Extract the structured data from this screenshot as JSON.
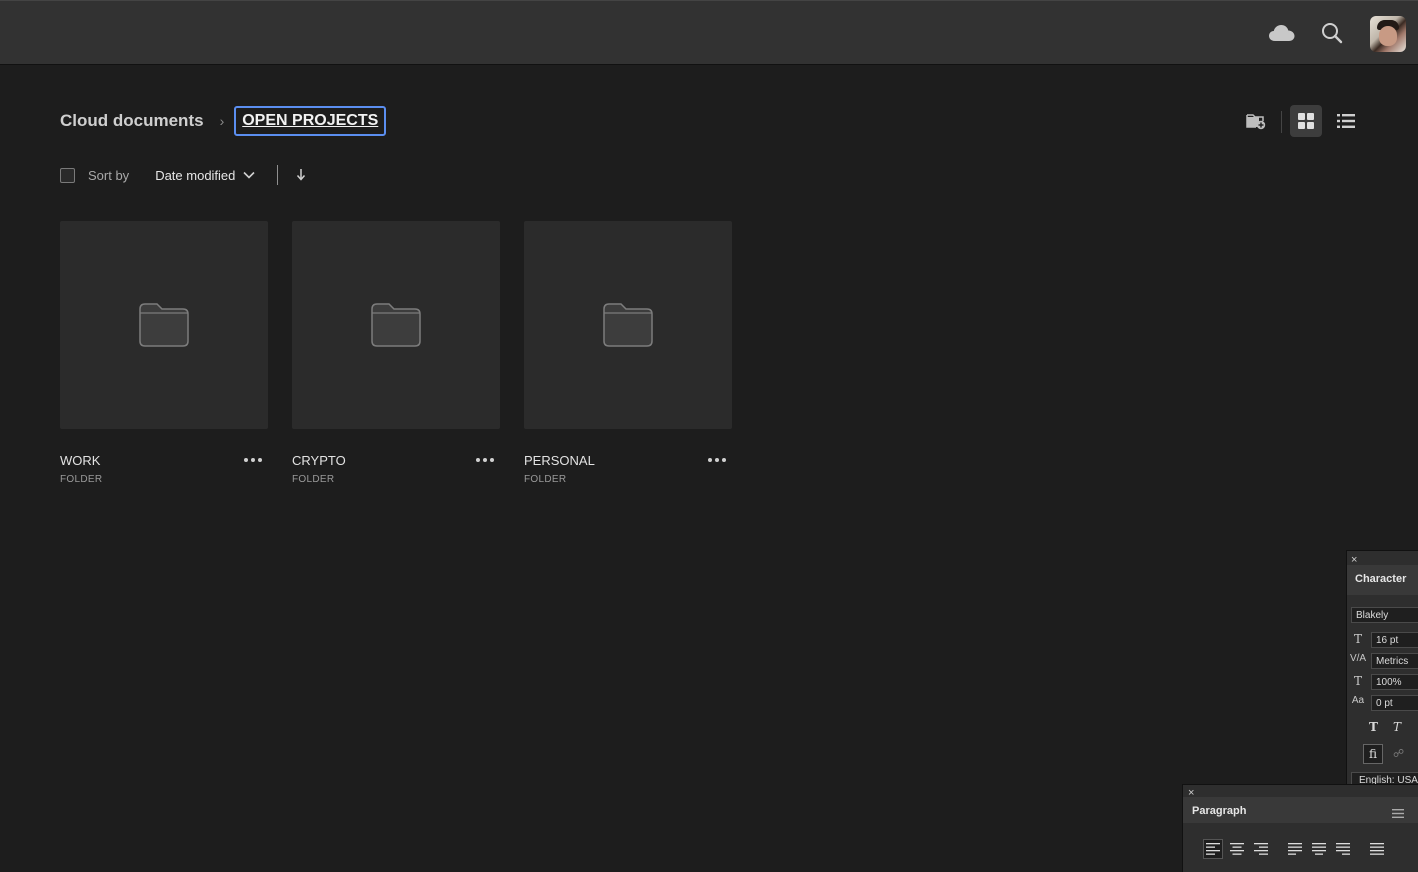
{
  "header": {
    "icons": [
      "cloud-icon",
      "search-icon",
      "user-avatar"
    ]
  },
  "breadcrumb": {
    "root": "Cloud documents",
    "separator": "›",
    "current": "OPEN PROJECTS"
  },
  "sort": {
    "label": "Sort by",
    "value": "Date modified",
    "direction_icon": "arrow-down-icon"
  },
  "view": {
    "mode": "grid",
    "icons": [
      "new-folder-icon",
      "grid-view-icon",
      "list-view-icon"
    ]
  },
  "folders": [
    {
      "name": "WORK",
      "type": "FOLDER"
    },
    {
      "name": "CRYPTO",
      "type": "FOLDER"
    },
    {
      "name": "PERSONAL",
      "type": "FOLDER"
    }
  ],
  "character_panel": {
    "close": "×",
    "tab": "Character",
    "font": "Blakely",
    "size": "16 pt",
    "kerning": "Metrics",
    "vertical_scale": "100%",
    "baseline_shift": "0 pt",
    "style_bold": "T",
    "style_italic": "T",
    "ligature": "fi",
    "language": "English: USA"
  },
  "paragraph_panel": {
    "close": "×",
    "tab": "Paragraph",
    "menu_icon": "hamburger-menu-icon",
    "alignments": [
      "align-left",
      "align-center",
      "align-right",
      "justify-left",
      "justify-center",
      "justify-right",
      "justify-all"
    ],
    "active_alignment": "align-left"
  },
  "colors": {
    "background": "#1d1d1d",
    "topbar": "#323232",
    "card": "#2b2b2b",
    "focus_ring": "#5b8ef0"
  }
}
